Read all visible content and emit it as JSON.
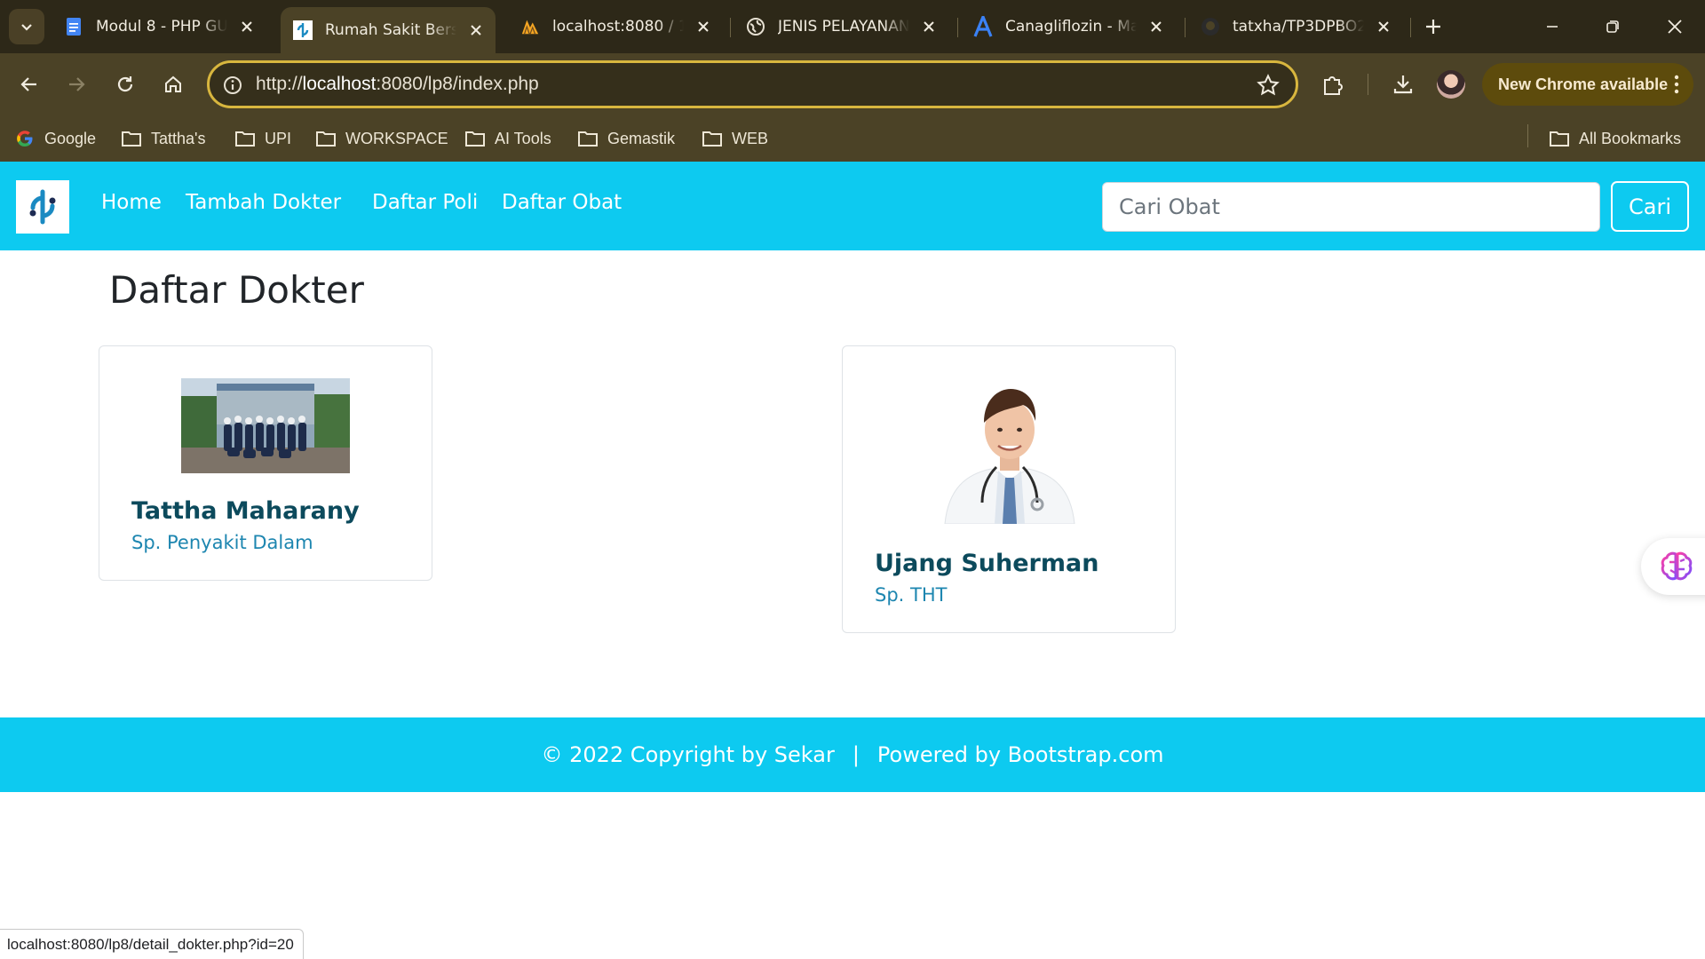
{
  "browser": {
    "tabs": [
      {
        "title": "Modul 8 - PHP GUI",
        "icon": "docs-icon"
      },
      {
        "title": "Rumah Sakit Bersih",
        "icon": "site-logo-icon",
        "active": true
      },
      {
        "title": "localhost:8080 / 127",
        "icon": "phpmyadmin-icon"
      },
      {
        "title": "JENIS PELAYANAN",
        "icon": "globe-icon"
      },
      {
        "title": "Canagliflozin - Ma",
        "icon": "letter-a-icon"
      },
      {
        "title": "tatxha/TP3DPBO2",
        "icon": "github-icon"
      }
    ],
    "url_prefix": "http://",
    "url_host": "localhost",
    "url_rest": ":8080/lp8/index.php",
    "update_label": "New Chrome available",
    "bookmarks": [
      "Google",
      "Tattha's",
      "UPI",
      "WORKSPACE",
      "AI Tools",
      "Gemastik",
      "WEB"
    ],
    "all_bookmarks": "All Bookmarks",
    "status_url": "localhost:8080/lp8/detail_dokter.php?id=20",
    "accent": "#d8b63e"
  },
  "site": {
    "nav": {
      "links": [
        "Home",
        "Tambah Dokter",
        "Daftar Poli",
        "Daftar Obat"
      ],
      "search_placeholder": "Cari Obat",
      "search_button": "Cari"
    },
    "page_title": "Daftar Dokter",
    "doctors": [
      {
        "name": "Tattha Maharany",
        "specialty": "Sp. Penyakit Dalam"
      },
      {
        "name": "Ujang Suherman",
        "specialty": "Sp. THT"
      }
    ],
    "footer": {
      "copyright": "© 2022 Copyright by Sekar",
      "separator": "|",
      "powered": "Powered by Bootstrap.com"
    },
    "theme_color": "#0dcaf0"
  }
}
